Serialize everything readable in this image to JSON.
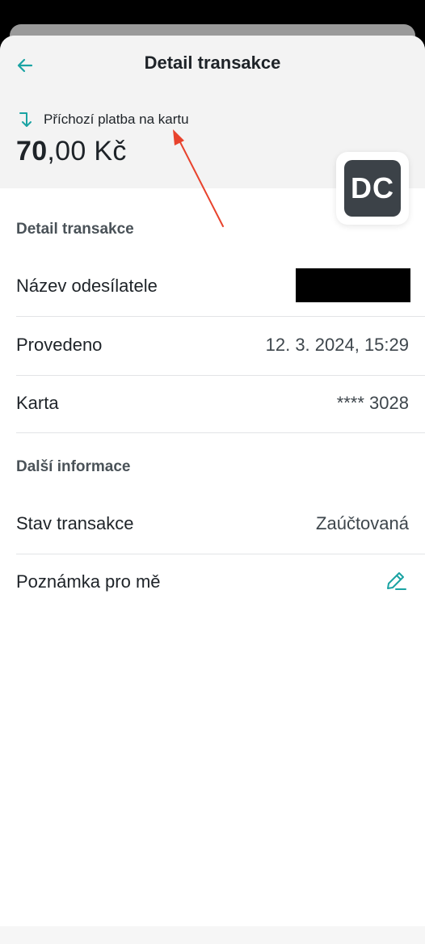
{
  "header": {
    "title": "Detail transakce",
    "back_icon": "arrow-left-icon",
    "transaction_type": "Příchozí platba na kartu",
    "type_icon": "incoming-arrow-icon",
    "amount_integer": "70",
    "amount_fraction": ",00",
    "currency": "Kč",
    "merchant_logo_text": "DC"
  },
  "detail_section": {
    "title": "Detail transakce",
    "rows": [
      {
        "label": "Název odesílatele",
        "value": ""
      },
      {
        "label": "Provedeno",
        "value": "12. 3. 2024, 15:29"
      },
      {
        "label": "Karta",
        "value": "**** 3028"
      }
    ]
  },
  "info_section": {
    "title": "Další informace",
    "rows": [
      {
        "label": "Stav transakce",
        "value": "Zaúčtovaná"
      },
      {
        "label": "Poznámka pro mě",
        "value": ""
      }
    ]
  },
  "colors": {
    "accent": "#1aa3a3",
    "text": "#1e2328",
    "annotation": "#e8432d"
  }
}
